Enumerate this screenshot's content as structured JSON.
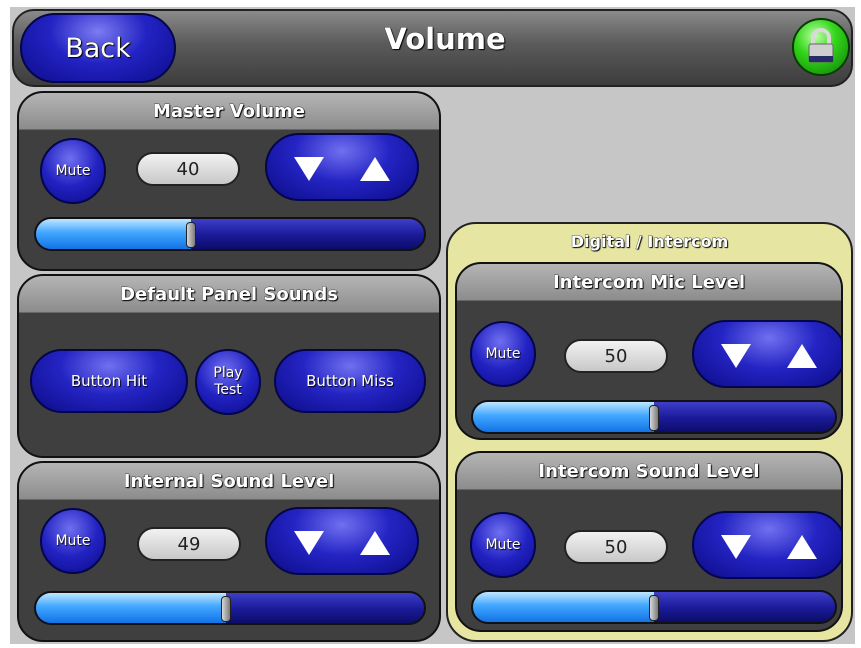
{
  "header": {
    "back_label": "Back",
    "title": "Volume",
    "lock_icon": "lock-icon"
  },
  "master": {
    "title": "Master Volume",
    "mute_label": "Mute",
    "value": "40",
    "level": 0.4
  },
  "default_sounds": {
    "title": "Default Panel Sounds",
    "button_hit": "Button Hit",
    "play_test": "Play\nTest",
    "button_miss": "Button Miss"
  },
  "internal": {
    "title": "Internal Sound Level",
    "mute_label": "Mute",
    "value": "49",
    "level": 0.49
  },
  "digital": {
    "title": "Digital / Intercom"
  },
  "mic": {
    "title": "Intercom Mic Level",
    "mute_label": "Mute",
    "value": "50",
    "level": 0.5
  },
  "intercom_sound": {
    "title": "Intercom Sound Level",
    "mute_label": "Mute",
    "value": "50",
    "level": 0.5
  },
  "colors": {
    "background": "#c6c6c6",
    "button_blue": "#2424c4",
    "slider_fill": "#42a7ff",
    "digital_panel": "#e6e6a2",
    "lock_green": "#33d61a"
  }
}
